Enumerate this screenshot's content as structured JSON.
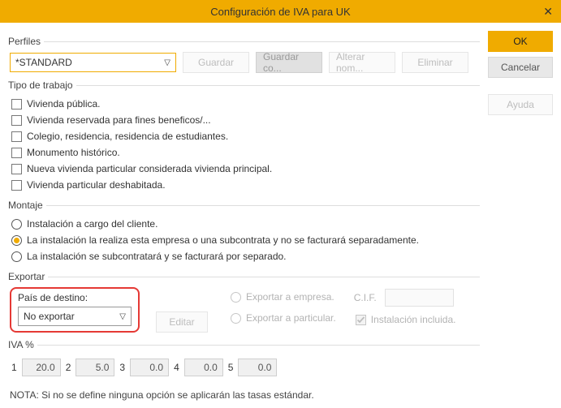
{
  "window": {
    "title": "Configuración de IVA para UK"
  },
  "side_buttons": {
    "ok": "OK",
    "cancel": "Cancelar",
    "help": "Ayuda"
  },
  "profiles": {
    "legend": "Perfiles",
    "selected": "*STANDARD",
    "buttons": {
      "save": "Guardar",
      "save_as": "Guardar co...",
      "rename": "Alterar nom...",
      "delete": "Eliminar"
    }
  },
  "work_type": {
    "legend": "Tipo de trabajo",
    "items": [
      "Vivienda pública.",
      "Vivienda reservada para fines beneficos/...",
      "Colegio, residencia, residencia de estudiantes.",
      "Monumento histórico.",
      "Nueva vivienda particular considerada vivienda principal.",
      "Vivienda particular deshabitada."
    ]
  },
  "installation": {
    "legend": "Montaje",
    "options": [
      "Instalación a cargo del cliente.",
      "La instalación la realiza esta empresa o una subcontrata y no se facturará separadamente.",
      "La instalación se subcontratará y se facturará por separado."
    ],
    "selected_index": 1
  },
  "export": {
    "legend": "Exportar",
    "dest_label": "País de destino:",
    "dest_value": "No exportar",
    "edit_btn": "Editar",
    "to_company": "Exportar a empresa.",
    "to_individual": "Exportar a particular.",
    "cif_label": "C.I.F.",
    "install_included": "Instalación incluida."
  },
  "iva": {
    "legend": "IVA %",
    "rates": [
      "20.0",
      "5.0",
      "0.0",
      "0.0",
      "0.0"
    ]
  },
  "note": "NOTA: Si no se define ninguna opción se aplicarán las tasas estándar.",
  "chart_data": {
    "type": "table",
    "title": "IVA %",
    "categories": [
      "1",
      "2",
      "3",
      "4",
      "5"
    ],
    "values": [
      20.0,
      5.0,
      0.0,
      0.0,
      0.0
    ]
  }
}
